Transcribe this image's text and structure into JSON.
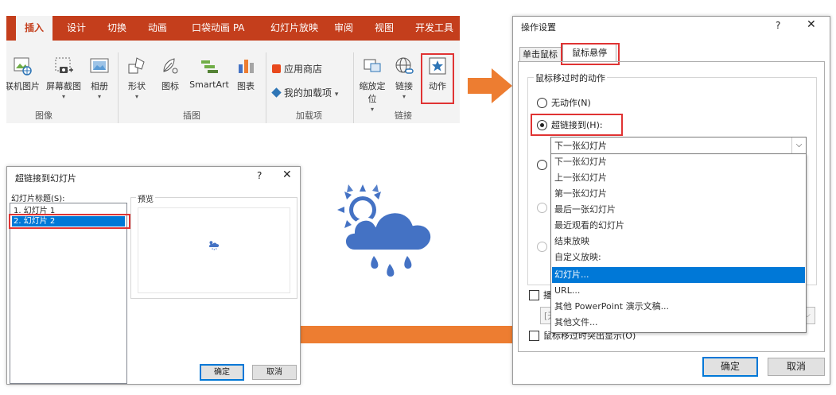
{
  "ribbon": {
    "tabs": [
      "插入",
      "设计",
      "切换",
      "动画",
      "口袋动画 PA",
      "幻灯片放映",
      "审阅",
      "视图",
      "开发工具"
    ],
    "active_tab": "插入",
    "buttons": {
      "online_pictures": "联机图片",
      "screenshot": "屏幕截图",
      "album": "相册",
      "shapes": "形状",
      "icons": "图标",
      "smartart": "SmartArt",
      "chart": "图表",
      "store": "应用商店",
      "my_addins": "我的加载项",
      "zoom": "缩放定位",
      "link": "链接",
      "action": "动作"
    },
    "groups": [
      "图像",
      "插图",
      "加载项",
      "链接"
    ]
  },
  "action_dialog": {
    "title": "操作设置",
    "help": "?",
    "close": "✕",
    "tabs": [
      "单击鼠标",
      "鼠标悬停"
    ],
    "active_tab": "鼠标悬停",
    "group_title": "鼠标移过时的动作",
    "none_action": "无动作(N)",
    "hyperlink_to": "超链接到(H):",
    "hyperlink_value": "下一张幻灯片",
    "dropdown_options": [
      "下一张幻灯片",
      "上一张幻灯片",
      "第一张幻灯片",
      "最后一张幻灯片",
      "最近观看的幻灯片",
      "结束放映",
      "自定义放映:",
      "幻灯片...",
      "URL...",
      "其他 PowerPoint 演示文稿...",
      "其他文件..."
    ],
    "dropdown_selected": "幻灯片...",
    "play_sound_partial": "播",
    "sound_value_partial": "[无",
    "highlight_label": "鼠标移过时突出显示(O)",
    "ok": "确定",
    "cancel": "取消"
  },
  "hyperlink_dialog": {
    "title": "超链接到幻灯片",
    "help": "?",
    "close": "✕",
    "list_label": "幻灯片标题(S):",
    "slides": [
      "1. 幻灯片 1",
      "2. 幻灯片 2"
    ],
    "selected_slide": "2. 幻灯片 2",
    "preview_label": "预览",
    "ok": "确定",
    "cancel": "取消"
  },
  "colors": {
    "ribbon_accent": "#c43e1c",
    "arrow": "#ed7d31",
    "weather_blue": "#4472c4",
    "highlight_red": "#e03333",
    "selection": "#0078d7"
  }
}
